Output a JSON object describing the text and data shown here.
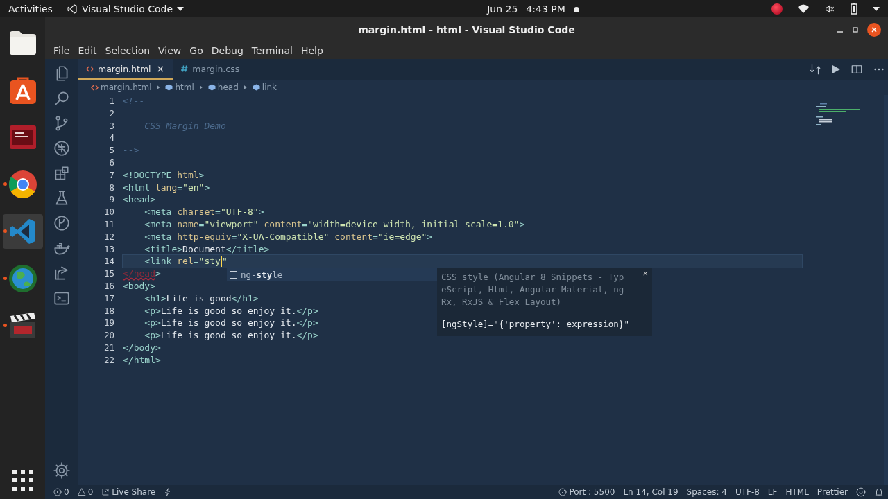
{
  "topbar": {
    "activities": "Activities",
    "app": "Visual Studio Code",
    "date": "Jun 25",
    "time": "4:43 PM"
  },
  "dock": {
    "items": [
      {
        "kind": "folder",
        "selected": false,
        "running": false
      },
      {
        "kind": "store",
        "selected": false,
        "running": false
      },
      {
        "kind": "monitor",
        "selected": false,
        "running": false
      },
      {
        "kind": "browser",
        "selected": false,
        "running": true
      },
      {
        "kind": "vscode",
        "selected": true,
        "running": true
      },
      {
        "kind": "globe",
        "selected": false,
        "running": true
      },
      {
        "kind": "clapper",
        "selected": false,
        "running": true
      }
    ]
  },
  "window": {
    "title": "margin.html - html - Visual Studio Code"
  },
  "menu": [
    "File",
    "Edit",
    "Selection",
    "View",
    "Go",
    "Debug",
    "Terminal",
    "Help"
  ],
  "activity_bar": [
    {
      "kind": "files"
    },
    {
      "kind": "search"
    },
    {
      "kind": "branch"
    },
    {
      "kind": "bug"
    },
    {
      "kind": "extensions"
    },
    {
      "kind": "flask"
    },
    {
      "kind": "history"
    },
    {
      "kind": "whale"
    },
    {
      "kind": "share"
    },
    {
      "kind": "terminal"
    }
  ],
  "tabs": [
    {
      "label": "margin.html",
      "kind": "html",
      "selected": true,
      "close": "×"
    },
    {
      "label": "margin.css",
      "kind": "css",
      "selected": false
    }
  ],
  "breadcrumbs": [
    {
      "label": "margin.html",
      "kind": "html"
    },
    {
      "label": "html",
      "kind": "element"
    },
    {
      "label": "head",
      "kind": "element"
    },
    {
      "label": "link",
      "kind": "element"
    }
  ],
  "editor": {
    "lines": [
      {
        "number": "1",
        "current": false,
        "tokens": [
          {
            "kind": "comment",
            "text": "<!--"
          }
        ]
      },
      {
        "number": "2",
        "current": false
      },
      {
        "number": "3",
        "current": false,
        "tokens": [
          {
            "kind": "comment",
            "text": "    CSS Margin Demo"
          }
        ]
      },
      {
        "number": "4",
        "current": false
      },
      {
        "number": "5",
        "current": false,
        "tokens": [
          {
            "kind": "comment",
            "text": "-->"
          }
        ]
      },
      {
        "number": "6",
        "current": false
      },
      {
        "number": "7",
        "current": false,
        "tokens": [
          {
            "kind": "tag",
            "text": "<!DOCTYPE "
          },
          {
            "kind": "attr",
            "text": "html"
          },
          {
            "kind": "tag",
            "text": ">"
          }
        ]
      },
      {
        "number": "8",
        "current": false,
        "tokens": [
          {
            "kind": "tag",
            "text": "<html "
          },
          {
            "kind": "attr",
            "text": "lang"
          },
          {
            "kind": "tag",
            "text": "="
          },
          {
            "kind": "string",
            "text": "\"en\""
          },
          {
            "kind": "tag",
            "text": ">"
          }
        ]
      },
      {
        "number": "9",
        "current": false,
        "tokens": [
          {
            "kind": "tag",
            "text": "<head>"
          }
        ]
      },
      {
        "number": "10",
        "current": false,
        "tokens": [
          {
            "kind": "tag",
            "text": "    <meta "
          },
          {
            "kind": "attr",
            "text": "charset"
          },
          {
            "kind": "tag",
            "text": "="
          },
          {
            "kind": "string",
            "text": "\"UTF-8\""
          },
          {
            "kind": "tag",
            "text": ">"
          }
        ]
      },
      {
        "number": "11",
        "current": false,
        "tokens": [
          {
            "kind": "tag",
            "text": "    <meta "
          },
          {
            "kind": "attr",
            "text": "name"
          },
          {
            "kind": "tag",
            "text": "="
          },
          {
            "kind": "string",
            "text": "\"viewport\" "
          },
          {
            "kind": "attr",
            "text": "content"
          },
          {
            "kind": "tag",
            "text": "="
          },
          {
            "kind": "string",
            "text": "\"width=device-width, initial-scale=1.0\""
          },
          {
            "kind": "tag",
            "text": ">"
          }
        ]
      },
      {
        "number": "12",
        "current": false,
        "tokens": [
          {
            "kind": "tag",
            "text": "    <meta "
          },
          {
            "kind": "attr",
            "text": "http-equiv"
          },
          {
            "kind": "tag",
            "text": "="
          },
          {
            "kind": "string",
            "text": "\"X-UA-Compatible\" "
          },
          {
            "kind": "attr",
            "text": "content"
          },
          {
            "kind": "tag",
            "text": "="
          },
          {
            "kind": "string",
            "text": "\"ie=edge\""
          },
          {
            "kind": "tag",
            "text": ">"
          }
        ]
      },
      {
        "number": "13",
        "current": false,
        "tokens": [
          {
            "kind": "tag",
            "text": "    <title>"
          },
          {
            "kind": "text",
            "text": "Document"
          },
          {
            "kind": "tag",
            "text": "</title>"
          }
        ]
      },
      {
        "number": "14",
        "current": true,
        "tokens": [
          {
            "kind": "tag",
            "text": "    <link "
          },
          {
            "kind": "attr",
            "text": "rel"
          },
          {
            "kind": "tag",
            "text": "="
          },
          {
            "kind": "string",
            "text": "\"sty"
          },
          {
            "kind": "cursor"
          },
          {
            "kind": "string",
            "text": "\""
          }
        ]
      },
      {
        "number": "15",
        "current": false,
        "tokens": [
          {
            "kind": "error",
            "text": "</head"
          },
          {
            "kind": "tag",
            "text": ">"
          }
        ]
      },
      {
        "number": "16",
        "current": false,
        "tokens": [
          {
            "kind": "tag",
            "text": "<body>"
          }
        ]
      },
      {
        "number": "17",
        "current": false,
        "tokens": [
          {
            "kind": "tag",
            "text": "    <h1>"
          },
          {
            "kind": "text",
            "text": "Life is good"
          },
          {
            "kind": "tag",
            "text": "</h1>"
          }
        ]
      },
      {
        "number": "18",
        "current": false,
        "tokens": [
          {
            "kind": "tag",
            "text": "    <p>"
          },
          {
            "kind": "text",
            "text": "Life is good so enjoy it."
          },
          {
            "kind": "tag",
            "text": "</p>"
          }
        ]
      },
      {
        "number": "19",
        "current": false,
        "tokens": [
          {
            "kind": "tag",
            "text": "    <p>"
          },
          {
            "kind": "text",
            "text": "Life is good so enjoy it."
          },
          {
            "kind": "tag",
            "text": "</p>"
          }
        ]
      },
      {
        "number": "20",
        "current": false,
        "tokens": [
          {
            "kind": "tag",
            "text": "    <p>"
          },
          {
            "kind": "text",
            "text": "Life is good so enjoy it."
          },
          {
            "kind": "tag",
            "text": "</p>"
          }
        ]
      },
      {
        "number": "21",
        "current": false,
        "tokens": [
          {
            "kind": "tag",
            "text": "</body>"
          }
        ]
      },
      {
        "number": "22",
        "current": false,
        "tokens": [
          {
            "kind": "tag",
            "text": "</html>"
          }
        ]
      }
    ]
  },
  "suggest": {
    "items": [
      {
        "label": "ng-**sty**le",
        "selected": true
      }
    ],
    "details": {
      "lines": [
        "CSS style (Angular 8 Snippets - Typ",
        "eScript, Html, Angular Material, ng",
        "Rx, RxJS & Flex Layout)"
      ],
      "code": "[ngStyle]=\"{'property': expression}\"",
      "close": "×"
    }
  },
  "status_bar": {
    "errors": "0",
    "warnings": "0",
    "live_share": "Live Share",
    "port": "Port : 5500",
    "position": "Ln 14, Col 19",
    "spaces": "Spaces: 4",
    "encoding": "UTF-8",
    "eol": "LF",
    "language": "HTML",
    "formatter": "Prettier"
  }
}
